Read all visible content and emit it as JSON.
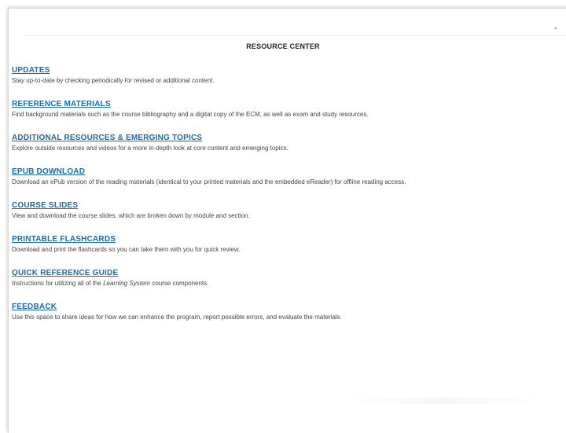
{
  "corner_mark": "-",
  "page_title": "RESOURCE CENTER",
  "sections": [
    {
      "heading": "UPDATES",
      "description": "Stay up-to-date by checking periodically for revised or additional content."
    },
    {
      "heading": "REFERENCE MATERIALS",
      "description": "Find background materials such as the course bibliography and a digital copy of the ECM, as well as exam and study resources."
    },
    {
      "heading": "ADDITIONAL RESOURCES & EMERGING TOPICS",
      "description": "Explore outside resources and videos for a more in-depth look at core content and emerging topics."
    },
    {
      "heading": "EPUB DOWNLOAD",
      "description": "Download an ePub version of the reading materials (identical to your printed materials and the embedded eReader) for offline reading access."
    },
    {
      "heading": "COURSE SLIDES",
      "description": "View and download the course slides, which are broken down by module and section."
    },
    {
      "heading": "PRINTABLE FLASHCARDS",
      "description": "Download and print the flashcards so you can take them with you for quick review."
    },
    {
      "heading": "QUICK REFERENCE GUIDE",
      "description_prefix": "Instructions for utilizing all of the ",
      "description_emphasis": "Learning System",
      "description_suffix": " course components."
    },
    {
      "heading": "FEEDBACK",
      "description": "Use this space to share ideas for how we can enhance the program, report possible errors, and evaluate the materials."
    }
  ],
  "colors": {
    "link": "#1c6aa6",
    "body_text": "#444444",
    "title_text": "#222222"
  }
}
